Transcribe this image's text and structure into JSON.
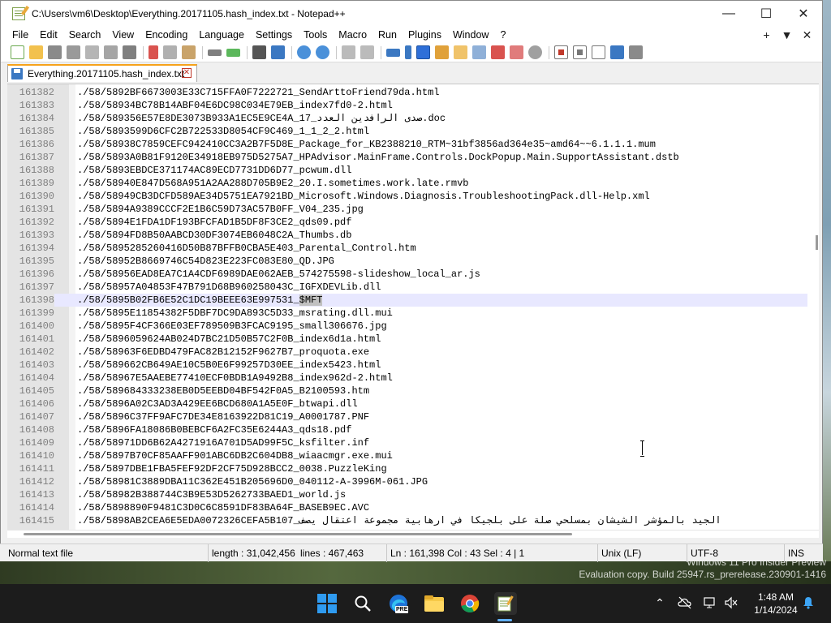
{
  "window": {
    "title": "C:\\Users\\vm6\\Desktop\\Everything.20171105.hash_index.txt - Notepad++",
    "minimize": "—",
    "maximize": "☐",
    "close": "✕"
  },
  "menu": {
    "items": [
      "File",
      "Edit",
      "Search",
      "View",
      "Encoding",
      "Language",
      "Settings",
      "Tools",
      "Macro",
      "Run",
      "Plugins",
      "Window",
      "?"
    ],
    "right": [
      "+",
      "▼",
      "✕"
    ]
  },
  "tab": {
    "label": "Everything.20171105.hash_index.txt",
    "close": "✕"
  },
  "editor": {
    "current_line_index": 16,
    "selection_text": "$MFT",
    "lines": [
      {
        "num": "161382",
        "text": "./58/5892BF6673003E33C715FFA0F7222721_SendArttoFriend79da.html"
      },
      {
        "num": "161383",
        "text": "./58/58934BC78B14ABF04E6DC98C034E79EB_index7fd0-2.html"
      },
      {
        "num": "161384",
        "text": "./58/589356E57E8DE3073B933A1EC5E9CE4A_17_صدى الرافدين العدد.doc"
      },
      {
        "num": "161385",
        "text": "./58/5893599D6CFC2B722533D8054CF9C469_1_1_2_2.html"
      },
      {
        "num": "161386",
        "text": "./58/58938C7859CEFC942410CC3A2B7F5D8E_Package_for_KB2388210_RTM~31bf3856ad364e35~amd64~~6.1.1.1.mum"
      },
      {
        "num": "161387",
        "text": "./58/5893A0B81F9120E34918EB975D5275A7_HPAdvisor.MainFrame.Controls.DockPopup.Main.SupportAssistant.dstb"
      },
      {
        "num": "161388",
        "text": "./58/5893EBDCE371174AC89ECD7731DD6D77_pcwum.dll"
      },
      {
        "num": "161389",
        "text": "./58/58940E847D568A951A2AA288D705B9E2_20.I.sometimes.work.late.rmvb"
      },
      {
        "num": "161390",
        "text": "./58/58949CB3DCFD589AE34D5751EA7921BD_Microsoft.Windows.Diagnosis.TroubleshootingPack.dll-Help.xml"
      },
      {
        "num": "161391",
        "text": "./58/5894A9389CCCF2E1B6C59D73AC57B0FF_V04_235.jpg"
      },
      {
        "num": "161392",
        "text": "./58/5894E1FDA1DF193BFCFAD1B5DF8F3CE2_qds09.pdf"
      },
      {
        "num": "161393",
        "text": "./58/5894FD8B50AABCD30DF3074EB6048C2A_Thumbs.db"
      },
      {
        "num": "161394",
        "text": "./58/5895285260416D50B87BFFB0CBA5E403_Parental_Control.htm"
      },
      {
        "num": "161395",
        "text": "./58/58952B8669746C54D823E223FC083E80_QD.JPG"
      },
      {
        "num": "161396",
        "text": "./58/58956EAD8EA7C1A4CDF6989DAE062AEB_574275598-slideshow_local_ar.js"
      },
      {
        "num": "161397",
        "text": "./58/58957A04853F47B791D68B960258043C_IGFXDEVLib.dll"
      },
      {
        "num": "161398",
        "text": "./58/5895B02FB6E52C1DC19BEEE63E997531_",
        "sel": "$MFT"
      },
      {
        "num": "161399",
        "text": "./58/5895E11854382F5DBF7DC9DA893C5D33_msrating.dll.mui"
      },
      {
        "num": "161400",
        "text": "./58/5895F4CF366E03EF789509B3FCAC9195_small306676.jpg"
      },
      {
        "num": "161401",
        "text": "./58/5896059624AB024D7BC21D50B57C2F0B_index6d1a.html"
      },
      {
        "num": "161402",
        "text": "./58/58963F6EDBD479FAC82B12152F9627B7_proquota.exe"
      },
      {
        "num": "161403",
        "text": "./58/589662CB649AE10C5B0E6F99257D30EE_index5423.html"
      },
      {
        "num": "161404",
        "text": "./58/58967E5AAEBE77410ECF0BDB1A9492B8_index962d-2.html"
      },
      {
        "num": "161405",
        "text": "./58/589684333238EB0D5EEBD04BF542F0A5_B2100593.htm"
      },
      {
        "num": "161406",
        "text": "./58/5896A02C3AD3A429EE6BCD680A1A5E0F_btwapi.dll"
      },
      {
        "num": "161407",
        "text": "./58/5896C37FF9AFC7DE34E8163922D81C19_A0001787.PNF"
      },
      {
        "num": "161408",
        "text": "./58/5896FA18086B0BEBCF6A2FC35E6244A3_qds18.pdf"
      },
      {
        "num": "161409",
        "text": "./58/58971DD6B62A4271916A701D5AD99F5C_ksfilter.inf"
      },
      {
        "num": "161410",
        "text": "./58/5897B70CF85AAFF901ABC6DB2C604DB8_wiaacmgr.exe.mui"
      },
      {
        "num": "161411",
        "text": "./58/5897DBE1FBA5FEF92DF2CF75D928BCC2_0038.PuzzleKing"
      },
      {
        "num": "161412",
        "text": "./58/58981C3889DBA11C362E451B205696D0_040112-A-3996M-061.JPG"
      },
      {
        "num": "161413",
        "text": "./58/58982B388744C3B9E53D5262733BAED1_world.js"
      },
      {
        "num": "161414",
        "text": "./58/5898890F9481C3D0C6C8591DF83BA64F_BASEB9EC.AVC"
      },
      {
        "num": "161415",
        "text": "./58/5898AB2CEA6E5EDA0072326CEFA5B107_الجيد بالمؤشر الشيشان بمسلحي صلة على بلجيكا في ارهابية مجموعة اعتقال يصف"
      }
    ]
  },
  "status": {
    "file_type": "Normal text file",
    "length": "length : 31,042,456",
    "lines": "lines : 467,463",
    "position": "Ln : 161,398    Col : 43    Sel : 4 | 1",
    "eol": "Unix (LF)",
    "encoding": "UTF-8",
    "mode": "INS"
  },
  "watermark": {
    "line1": "Windows 11 Pro Insider Preview",
    "line2": "Evaluation copy. Build 25947.rs_prerelease.230901-1416"
  },
  "taskbar": {
    "time": "1:48 AM",
    "date": "1/14/2024",
    "chevron": "⌃",
    "edge_badge": "PRE"
  }
}
